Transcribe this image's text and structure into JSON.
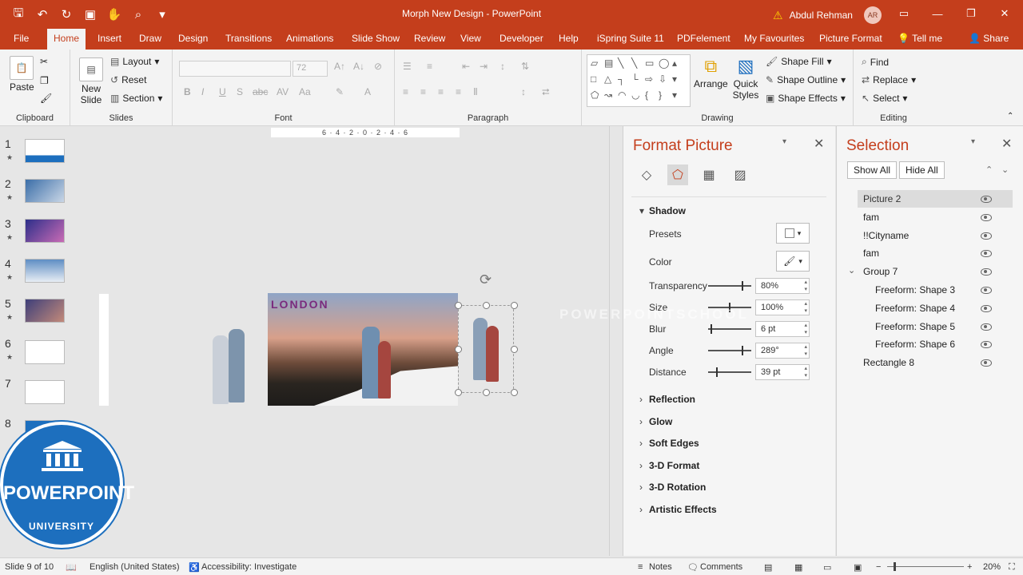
{
  "window": {
    "title": "Morph New Design  -  PowerPoint",
    "user": "Abdul Rehman",
    "user_initials": "AR"
  },
  "tabs": [
    "File",
    "Home",
    "Insert",
    "Draw",
    "Design",
    "Transitions",
    "Animations",
    "Slide Show",
    "Review",
    "View",
    "Developer",
    "Help",
    "iSpring Suite 11",
    "PDFelement",
    "My Favourites",
    "Picture Format",
    "Tell me",
    "Share"
  ],
  "ribbon": {
    "clipboard": {
      "label": "Clipboard",
      "paste": "Paste"
    },
    "slides": {
      "label": "Slides",
      "new_slide": "New Slide",
      "layout": "Layout",
      "reset": "Reset",
      "section": "Section"
    },
    "font": {
      "label": "Font",
      "size": "72"
    },
    "paragraph": {
      "label": "Paragraph"
    },
    "drawing": {
      "label": "Drawing",
      "arrange": "Arrange",
      "quick_styles": "Quick Styles",
      "shape_fill": "Shape Fill",
      "shape_outline": "Shape Outline",
      "shape_effects": "Shape Effects"
    },
    "editing": {
      "label": "Editing",
      "find": "Find",
      "replace": "Replace",
      "select": "Select"
    }
  },
  "thumbnails": [
    "1",
    "2",
    "3",
    "4",
    "5",
    "6",
    "7",
    "8"
  ],
  "slide": {
    "caption": "LONDON",
    "ruler_text": "6 · 4 · 2 · 0 · 2 · 4 · 6"
  },
  "format_picture": {
    "title": "Format Picture",
    "shadow": "Shadow",
    "presets": "Presets",
    "color": "Color",
    "props": [
      {
        "label": "Transparency",
        "value": "80%",
        "pos": 0.8
      },
      {
        "label": "Size",
        "value": "100%",
        "pos": 0.5
      },
      {
        "label": "Blur",
        "value": "6 pt",
        "pos": 0.05
      },
      {
        "label": "Angle",
        "value": "289°",
        "pos": 0.8
      },
      {
        "label": "Distance",
        "value": "39 pt",
        "pos": 0.2
      }
    ],
    "sections": [
      "Reflection",
      "Glow",
      "Soft Edges",
      "3-D Format",
      "3-D Rotation",
      "Artistic Effects"
    ]
  },
  "selection": {
    "title": "Selection",
    "show_all": "Show All",
    "hide_all": "Hide All",
    "items": [
      {
        "name": "Picture 2",
        "indent": 0,
        "selected": true
      },
      {
        "name": "fam",
        "indent": 0
      },
      {
        "name": "!!Cityname",
        "indent": 0
      },
      {
        "name": "fam",
        "indent": 0
      },
      {
        "name": "Group 7",
        "indent": 0,
        "group": true
      },
      {
        "name": "Freeform: Shape 3",
        "indent": 1
      },
      {
        "name": "Freeform: Shape 4",
        "indent": 1
      },
      {
        "name": "Freeform: Shape 5",
        "indent": 1
      },
      {
        "name": "Freeform: Shape 6",
        "indent": 1
      },
      {
        "name": "Rectangle 8",
        "indent": 0
      }
    ]
  },
  "status": {
    "slide": "Slide 9 of 10",
    "language": "English (United States)",
    "accessibility": "Accessibility: Investigate",
    "notes": "Notes",
    "comments": "Comments",
    "zoom": "20%"
  },
  "badge": {
    "line1": "POWERPOINT",
    "line2": "UNIVERSITY"
  },
  "watermark": "POWERPOINTSCHOOL",
  "colors": {
    "accent": "#c43e1c",
    "badge": "#1d6fbe"
  }
}
